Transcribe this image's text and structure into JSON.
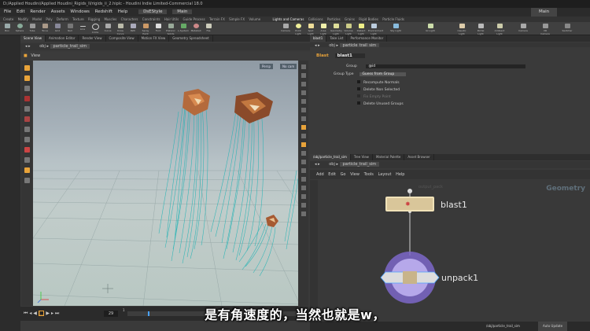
{
  "window": {
    "title": "D:/Applied Houdini/Applied Houdini_Rigids_II/rigids_ii_2.hiplc - Houdini Indie Limited-Commercial 18.0"
  },
  "menu": [
    "File",
    "Edit",
    "Render",
    "Assets",
    "Windows",
    "Redshift",
    "Help"
  ],
  "desktop": {
    "name": "DsEStyle",
    "mode": "Main"
  },
  "shelf_tabs": [
    "Create",
    "Modify",
    "Model",
    "Poly",
    "Deform",
    "Texture",
    "Rigging",
    "Muscles",
    "Characters",
    "Constraints",
    "Hair Utils",
    "Guide Process",
    "Terrain FX",
    "Simple FX",
    "Volume"
  ],
  "shelf_tools": [
    "Box",
    "Sphere",
    "Tube",
    "Torus",
    "Grid",
    "Null",
    "Line",
    "Circle",
    "Curve",
    "Draw Curve",
    "Path",
    "Spray Paint",
    "Font",
    "Platonic Solids",
    "L-System",
    "Metaball",
    "File"
  ],
  "light_tabs": [
    "Lights and Cameras",
    "Collisions",
    "Particles",
    "Grains",
    "Rigid Bodies",
    "Particle Fluids",
    "Viscous Fluids",
    "Oceans",
    "Fluid Containers",
    "Populate Containers",
    "Container Tools",
    "Pyro FX",
    "Sparse Pyro FX",
    "FEM",
    "Wires",
    "Crowds",
    "Drive Simulation"
  ],
  "light_tools": [
    "Camera",
    "Point Light",
    "Spot Light",
    "Area Light",
    "Geometry Light",
    "Volume Light",
    "Distant Light",
    "Environment Light",
    "Sky Light",
    "GI Light",
    "Caustic Light",
    "Portal Light",
    "Ambient Light",
    "Camera",
    "VR Camera",
    "Switcher"
  ],
  "left_tabs": [
    "Scene View",
    "Animation Editor",
    "Render View",
    "Composite View",
    "Motion FX View",
    "Geometry Spreadsheet"
  ],
  "left_path": {
    "network": "obj",
    "node": "particle_trail_sim"
  },
  "viewport": {
    "label": "View",
    "camera": "Persp",
    "cam_menu": "No cam"
  },
  "timeline": {
    "current_frame": "29",
    "start": "1",
    "end": "120",
    "end2": "120",
    "tick_30": "30",
    "tick_1": "1"
  },
  "right_top_tabs": [
    "blast1",
    "Take List",
    "Performance Monitor"
  ],
  "right_path": {
    "network": "obj",
    "node": "particle_trail_sim"
  },
  "params": {
    "node_type": "Blast",
    "node_name": "blast1",
    "group_label": "Group",
    "group_value": "@id",
    "group_type_label": "Group Type",
    "group_type_value": "Guess from Group",
    "checkboxes": [
      "Recompute Normals",
      "Delete Non Selected",
      "Fix Empty Point",
      "Delete Unused Groups"
    ]
  },
  "net_tabs": [
    "/obj/particle_trail_sim",
    "Tree View",
    "Material Palette",
    "Asset Browser"
  ],
  "net_path": {
    "network": "obj",
    "node": "particle_trail_sim"
  },
  "net_menu": [
    "Add",
    "Edit",
    "Go",
    "View",
    "Tools",
    "Layout",
    "Help"
  ],
  "net_label": "Geometry",
  "nodes": {
    "blast": "blast1",
    "unpack": "unpack1",
    "parent_hint": "output_pack"
  },
  "status": {
    "path": "/obj/particle_trail_sim",
    "update": "Auto Update"
  },
  "subtitle": "是有角速度的，当然也就是w，",
  "colors": {
    "trail": "#1fb3b4",
    "accent": "#e8a33a",
    "node_blast": "#d9c69a",
    "node_unpack": "#7d67c9"
  }
}
